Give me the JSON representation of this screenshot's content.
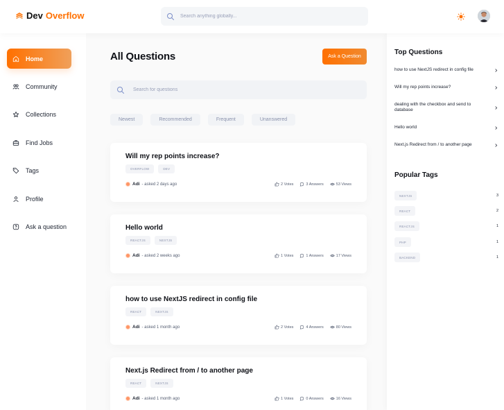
{
  "brand": {
    "part1": "Dev",
    "part2": "Overflow",
    "accent": "#ff7000"
  },
  "navbar": {
    "search_placeholder": "Search anything globally..."
  },
  "sidebar": {
    "items": [
      {
        "label": "Home",
        "icon": "home-icon",
        "active": true
      },
      {
        "label": "Community",
        "icon": "users-icon",
        "active": false
      },
      {
        "label": "Collections",
        "icon": "star-icon",
        "active": false
      },
      {
        "label": "Find Jobs",
        "icon": "suitcase-icon",
        "active": false
      },
      {
        "label": "Tags",
        "icon": "tag-icon",
        "active": false
      },
      {
        "label": "Profile",
        "icon": "user-icon",
        "active": false
      },
      {
        "label": "Ask a question",
        "icon": "question-icon",
        "active": false
      }
    ]
  },
  "main": {
    "title": "All Questions",
    "ask_label": "Ask a Question",
    "search_placeholder": "Search for questions",
    "filters": [
      "Newest",
      "Recommended",
      "Frequent",
      "Unanswered"
    ],
    "questions": [
      {
        "title": "Will my rep points increase?",
        "tags": [
          "OVERFLOW",
          "DEV"
        ],
        "author": "Adi",
        "asked": "- asked 2 days ago",
        "votes": "2 Votes",
        "answers": "3 Answers",
        "views": "53 Views"
      },
      {
        "title": "Hello world",
        "tags": [
          "REACTJS",
          "NEXTJS"
        ],
        "author": "Adi",
        "asked": "- asked 2 weeks ago",
        "votes": "1 Votes",
        "answers": "1 Answers",
        "views": "17 Views"
      },
      {
        "title": "how to use NextJS redirect in config file",
        "tags": [
          "REACT",
          "NEXTJS"
        ],
        "author": "Adi",
        "asked": "- asked 1 month ago",
        "votes": "2 Votes",
        "answers": "4 Answers",
        "views": "80 Views"
      },
      {
        "title": "Next.js Redirect from / to another page",
        "tags": [
          "REACT",
          "NEXTJS"
        ],
        "author": "Adi",
        "asked": "- asked 1 month ago",
        "votes": "1 Votes",
        "answers": "0 Answers",
        "views": "16 Views"
      }
    ]
  },
  "right": {
    "top_title": "Top Questions",
    "top_questions": [
      "how to use NextJS redirect in config file",
      "Will my rep points increase?",
      "dealing with the checkbox and send to database",
      "Hello world",
      "Next.js Redirect from / to another page"
    ],
    "tags_title": "Popular Tags",
    "popular_tags": [
      {
        "name": "NEXTJS",
        "count": "3"
      },
      {
        "name": "REACT",
        "count": "2"
      },
      {
        "name": "REACTJS",
        "count": "1"
      },
      {
        "name": "PHP",
        "count": "1"
      },
      {
        "name": "BACKEND",
        "count": "1"
      }
    ]
  }
}
